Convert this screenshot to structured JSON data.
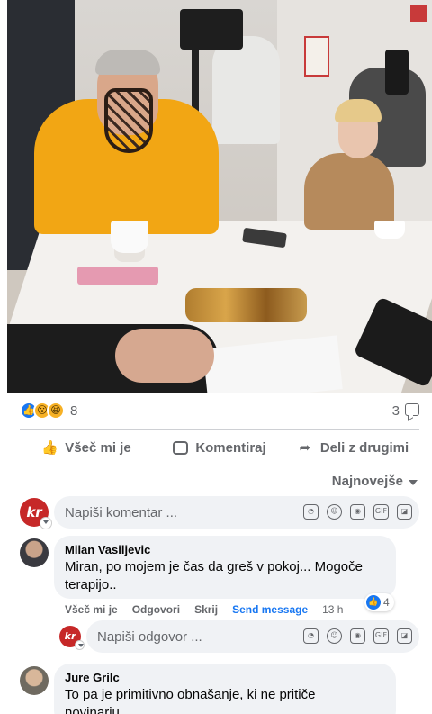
{
  "post": {
    "reactions": {
      "icons": [
        "like-icon",
        "wow-icon",
        "haha-icon"
      ],
      "count": "8"
    },
    "comment_count": "3"
  },
  "actions": {
    "like": "Všeč mi je",
    "comment": "Komentiraj",
    "share": "Deli z drugimi"
  },
  "sort": {
    "label": "Najnovejše"
  },
  "composer": {
    "placeholder": "Napiši komentar ..."
  },
  "comments": [
    {
      "author": "Milan Vasiljevic",
      "text_line1": "Miran, po mojem je čas da greš v pokoj... Mogoče",
      "text_line2": "terapijo..",
      "actions": {
        "like": "Všeč mi je",
        "reply": "Odgovori",
        "hide": "Skrij",
        "send": "Send message",
        "time": "13 h"
      },
      "like_count": "4"
    },
    {
      "author": "Jure Grilc",
      "text_line1": "To pa je primitivno obnašanje, ki ne pritiče",
      "text_line2": "novinarju"
    }
  ],
  "reply_composer": {
    "placeholder": "Napiši odgovor ..."
  },
  "colors": {
    "accent": "#1877f2",
    "brand_red": "#c62828",
    "muted_text": "#65676b",
    "bubble_bg": "#f0f2f5"
  }
}
